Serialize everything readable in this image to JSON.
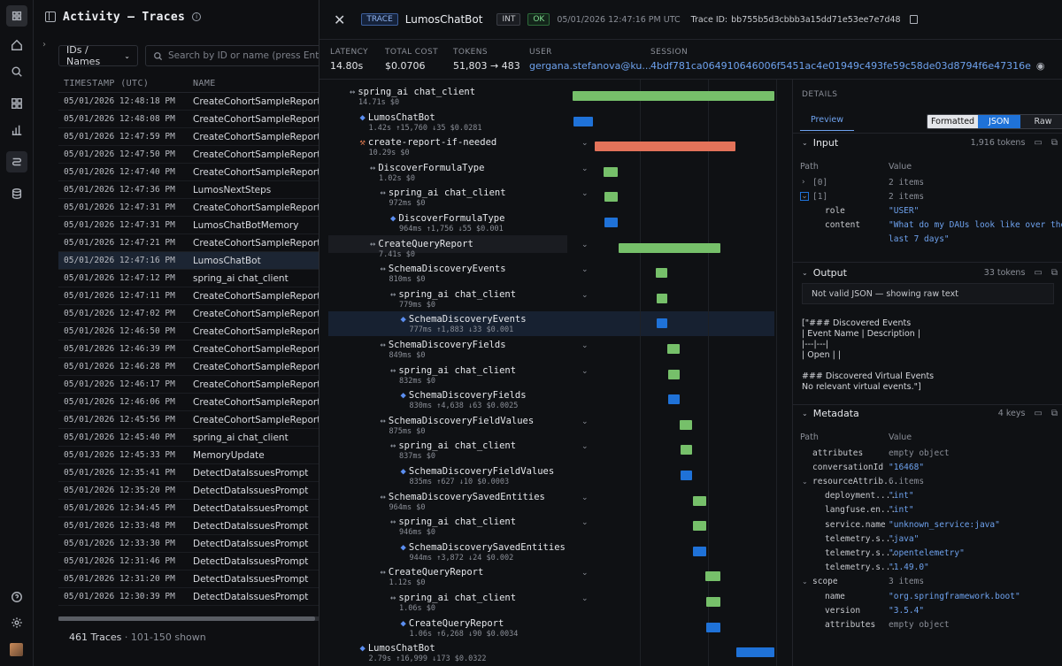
{
  "sidebar": {
    "icons": [
      "app-icon",
      "home-icon",
      "search-icon",
      "grid-icon",
      "chart-icon",
      "traces-icon",
      "database-icon",
      "help-icon",
      "settings-icon",
      "avatar"
    ]
  },
  "list": {
    "title": "Activity — Traces",
    "filter": "IDs / Names",
    "search_placeholder": "Search by ID or name (press Enter)",
    "col_ts": "TIMESTAMP (UTC)",
    "col_name": "NAME",
    "rows": [
      {
        "ts": "05/01/2026 12:48:18 PM",
        "name": "CreateCohortSampleReport"
      },
      {
        "ts": "05/01/2026 12:48:08 PM",
        "name": "CreateCohortSampleReport"
      },
      {
        "ts": "05/01/2026 12:47:59 PM",
        "name": "CreateCohortSampleReport"
      },
      {
        "ts": "05/01/2026 12:47:50 PM",
        "name": "CreateCohortSampleReport"
      },
      {
        "ts": "05/01/2026 12:47:40 PM",
        "name": "CreateCohortSampleReport"
      },
      {
        "ts": "05/01/2026 12:47:36 PM",
        "name": "LumosNextSteps"
      },
      {
        "ts": "05/01/2026 12:47:31 PM",
        "name": "CreateCohortSampleReport"
      },
      {
        "ts": "05/01/2026 12:47:31 PM",
        "name": "LumosChatBotMemory"
      },
      {
        "ts": "05/01/2026 12:47:21 PM",
        "name": "CreateCohortSampleReport"
      },
      {
        "ts": "05/01/2026 12:47:16 PM",
        "name": "LumosChatBot"
      },
      {
        "ts": "05/01/2026 12:47:12 PM",
        "name": "spring_ai chat_client"
      },
      {
        "ts": "05/01/2026 12:47:11 PM",
        "name": "CreateCohortSampleReport"
      },
      {
        "ts": "05/01/2026 12:47:02 PM",
        "name": "CreateCohortSampleReport"
      },
      {
        "ts": "05/01/2026 12:46:50 PM",
        "name": "CreateCohortSampleReport"
      },
      {
        "ts": "05/01/2026 12:46:39 PM",
        "name": "CreateCohortSampleReport"
      },
      {
        "ts": "05/01/2026 12:46:28 PM",
        "name": "CreateCohortSampleReport"
      },
      {
        "ts": "05/01/2026 12:46:17 PM",
        "name": "CreateCohortSampleReport"
      },
      {
        "ts": "05/01/2026 12:46:06 PM",
        "name": "CreateCohortSampleReport"
      },
      {
        "ts": "05/01/2026 12:45:56 PM",
        "name": "CreateCohortSampleReport"
      },
      {
        "ts": "05/01/2026 12:45:40 PM",
        "name": "spring_ai chat_client"
      },
      {
        "ts": "05/01/2026 12:45:33 PM",
        "name": "MemoryUpdate"
      },
      {
        "ts": "05/01/2026 12:35:41 PM",
        "name": "DetectDataIssuesPrompt"
      },
      {
        "ts": "05/01/2026 12:35:20 PM",
        "name": "DetectDataIssuesPrompt"
      },
      {
        "ts": "05/01/2026 12:34:45 PM",
        "name": "DetectDataIssuesPrompt"
      },
      {
        "ts": "05/01/2026 12:33:48 PM",
        "name": "DetectDataIssuesPrompt"
      },
      {
        "ts": "05/01/2026 12:33:30 PM",
        "name": "DetectDataIssuesPrompt"
      },
      {
        "ts": "05/01/2026 12:31:46 PM",
        "name": "DetectDataIssuesPrompt"
      },
      {
        "ts": "05/01/2026 12:31:20 PM",
        "name": "DetectDataIssuesPrompt"
      },
      {
        "ts": "05/01/2026 12:30:39 PM",
        "name": "DetectDataIssuesPrompt"
      }
    ],
    "footer_count": "461 Traces",
    "footer_range": "· 101-150 shown"
  },
  "trace": {
    "badge": "TRACE",
    "name": "LumosChatBot",
    "env": "INT",
    "status": "OK",
    "time": "05/01/2026 12:47:16 PM UTC",
    "trace_id_label": "Trace ID:",
    "trace_id": "bb755b5d3cbbb3a15dd71e53ee7e7d48",
    "stats": [
      {
        "label": "LATENCY",
        "value": "14.80s"
      },
      {
        "label": "TOTAL COST",
        "value": "$0.0706"
      },
      {
        "label": "TOKENS",
        "value": "51,803 → 483"
      },
      {
        "label": "USER",
        "value": "gergana.stefanova@ku..."
      },
      {
        "label": "SESSION",
        "value": "4bdf781ca064910646006f5451ac4e01949c493fe59c58de03d8794f6e47316e"
      }
    ]
  },
  "tree": [
    {
      "name": "spring_ai chat_client",
      "meta": "14.71s $0",
      "kind": "span"
    },
    {
      "name": "LumosChatBot",
      "meta": "1.42s ↑15,760 ↓35 $0.0281",
      "kind": "llm"
    },
    {
      "name": "create-report-if-needed",
      "meta": "10.29s $0",
      "kind": "tool"
    },
    {
      "name": "DiscoverFormulaType",
      "meta": "1.02s $0",
      "kind": "span"
    },
    {
      "name": "spring_ai chat_client",
      "meta": "972ms $0",
      "kind": "span"
    },
    {
      "name": "DiscoverFormulaType",
      "meta": "964ms ↑1,756 ↓55 $0.001",
      "kind": "llm"
    },
    {
      "name": "CreateQueryReport",
      "meta": "7.41s $0",
      "kind": "span"
    },
    {
      "name": "SchemaDiscoveryEvents",
      "meta": "810ms $0",
      "kind": "span"
    },
    {
      "name": "spring_ai chat_client",
      "meta": "779ms $0",
      "kind": "span"
    },
    {
      "name": "SchemaDiscoveryEvents",
      "meta": "777ms ↑1,883 ↓33 $0.001",
      "kind": "llm"
    },
    {
      "name": "SchemaDiscoveryFields",
      "meta": "849ms $0",
      "kind": "span"
    },
    {
      "name": "spring_ai chat_client",
      "meta": "832ms $0",
      "kind": "span"
    },
    {
      "name": "SchemaDiscoveryFields",
      "meta": "830ms ↑4,638 ↓63 $0.0025",
      "kind": "llm"
    },
    {
      "name": "SchemaDiscoveryFieldValues",
      "meta": "875ms $0",
      "kind": "span"
    },
    {
      "name": "spring_ai chat_client",
      "meta": "837ms $0",
      "kind": "span"
    },
    {
      "name": "SchemaDiscoveryFieldValues",
      "meta": "835ms ↑627 ↓10 $0.0003",
      "kind": "llm"
    },
    {
      "name": "SchemaDiscoverySavedEntities",
      "meta": "964ms $0",
      "kind": "span"
    },
    {
      "name": "spring_ai chat_client",
      "meta": "946ms $0",
      "kind": "span"
    },
    {
      "name": "SchemaDiscoverySavedEntities",
      "meta": "944ms ↑3,872 ↓24 $0.002",
      "kind": "llm"
    },
    {
      "name": "CreateQueryReport",
      "meta": "1.12s $0",
      "kind": "span"
    },
    {
      "name": "spring_ai chat_client",
      "meta": "1.06s $0",
      "kind": "span"
    },
    {
      "name": "CreateQueryReport",
      "meta": "1.06s ↑6,268 ↓90 $0.0034",
      "kind": "llm"
    },
    {
      "name": "LumosChatBot",
      "meta": "2.79s ↑16,999 ↓173 $0.0322",
      "kind": "llm"
    }
  ],
  "timeline": [
    {
      "start": 0.0,
      "end": 1.0,
      "color": "green"
    },
    {
      "start": 0.006,
      "end": 0.102,
      "color": "blue"
    },
    {
      "start": 0.108,
      "end": 0.807,
      "color": "orange"
    },
    {
      "start": 0.153,
      "end": 0.222,
      "color": "green"
    },
    {
      "start": 0.157,
      "end": 0.223,
      "color": "green"
    },
    {
      "start": 0.158,
      "end": 0.223,
      "color": "blue"
    },
    {
      "start": 0.229,
      "end": 0.733,
      "color": "green"
    },
    {
      "start": 0.413,
      "end": 0.468,
      "color": "green"
    },
    {
      "start": 0.416,
      "end": 0.469,
      "color": "green"
    },
    {
      "start": 0.417,
      "end": 0.47,
      "color": "blue"
    },
    {
      "start": 0.471,
      "end": 0.529,
      "color": "green"
    },
    {
      "start": 0.473,
      "end": 0.53,
      "color": "green"
    },
    {
      "start": 0.474,
      "end": 0.53,
      "color": "blue"
    },
    {
      "start": 0.532,
      "end": 0.591,
      "color": "green"
    },
    {
      "start": 0.534,
      "end": 0.591,
      "color": "green"
    },
    {
      "start": 0.535,
      "end": 0.592,
      "color": "blue"
    },
    {
      "start": 0.595,
      "end": 0.661,
      "color": "green"
    },
    {
      "start": 0.597,
      "end": 0.661,
      "color": "green"
    },
    {
      "start": 0.598,
      "end": 0.662,
      "color": "blue"
    },
    {
      "start": 0.657,
      "end": 0.733,
      "color": "green"
    },
    {
      "start": 0.661,
      "end": 0.733,
      "color": "green"
    },
    {
      "start": 0.662,
      "end": 0.734,
      "color": "blue"
    },
    {
      "start": 0.81,
      "end": 1.0,
      "color": "blue"
    }
  ],
  "details": {
    "title": "DETAILS",
    "tab": "Preview",
    "modes": [
      "Formatted",
      "JSON",
      "Raw"
    ],
    "input": {
      "title": "Input",
      "tokens": "1,916 tokens",
      "path_h": "Path",
      "value_h": "Value",
      "rows": [
        {
          "k": "[0]",
          "v": "2 items"
        },
        {
          "k": "[1]",
          "v": "2 items"
        },
        {
          "k": "role",
          "v": "\"USER\""
        },
        {
          "k": "content",
          "v": "\"What do my DAUs look like over the"
        },
        {
          "k": "",
          "v": "last 7 days\""
        }
      ]
    },
    "output": {
      "title": "Output",
      "tokens": "33 tokens",
      "note": "Not valid JSON — showing raw text",
      "lines": [
        "[\"### Discovered Events",
        "| Event Name | Description |",
        "|---|---|",
        "| Open |  |",
        "",
        "### Discovered Virtual Events",
        "No relevant virtual events.\"]"
      ]
    },
    "metadata": {
      "title": "Metadata",
      "keys": "4 keys",
      "path_h": "Path",
      "value_h": "Value",
      "rows": [
        {
          "k": "attributes",
          "v": "empty object"
        },
        {
          "k": "conversationId",
          "v": "\"16468\""
        },
        {
          "k": "resourceAttrib...",
          "v": "6 items"
        },
        {
          "k": "deployment....",
          "v": "\"int\""
        },
        {
          "k": "langfuse.en...",
          "v": "\"int\""
        },
        {
          "k": "service.name",
          "v": "\"unknown_service:java\""
        },
        {
          "k": "telemetry.s...",
          "v": "\"java\""
        },
        {
          "k": "telemetry.s...",
          "v": "\"opentelemetry\""
        },
        {
          "k": "telemetry.s...",
          "v": "\"1.49.0\""
        },
        {
          "k": "scope",
          "v": "3 items"
        },
        {
          "k": "name",
          "v": "\"org.springframework.boot\""
        },
        {
          "k": "version",
          "v": "\"3.5.4\""
        },
        {
          "k": "attributes",
          "v": "empty object"
        }
      ]
    }
  }
}
